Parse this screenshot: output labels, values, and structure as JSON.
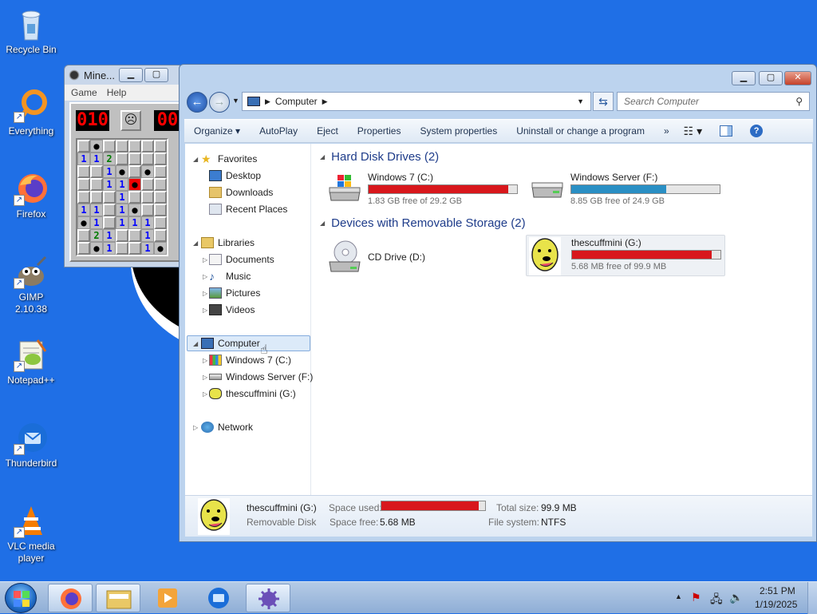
{
  "desktop": {
    "icons": [
      {
        "name": "recycle-bin",
        "label": "Recycle Bin"
      },
      {
        "name": "everything",
        "label": "Everything"
      },
      {
        "name": "firefox",
        "label": "Firefox"
      },
      {
        "name": "gimp",
        "label": "GIMP 2.10.38"
      },
      {
        "name": "notepadpp",
        "label": "Notepad++"
      },
      {
        "name": "thunderbird",
        "label": "Thunderbird"
      },
      {
        "name": "vlc",
        "label": "VLC media player"
      }
    ]
  },
  "minesweeper": {
    "title": "Mine...",
    "menu": [
      "Game",
      "Help"
    ],
    "mine_counter": "010",
    "timer": "00",
    "grid": [
      [
        "",
        "*",
        "",
        "",
        "",
        "",
        ""
      ],
      [
        "1",
        "1",
        "2",
        "",
        "",
        "",
        ""
      ],
      [
        "",
        "",
        "1",
        "*",
        "",
        "*",
        ""
      ],
      [
        "",
        "",
        "1",
        "1",
        "X",
        "",
        ""
      ],
      [
        "",
        "",
        "",
        "1",
        "",
        "",
        ""
      ],
      [
        "1",
        "1",
        "",
        "1",
        "*",
        "",
        ""
      ],
      [
        "*",
        "1",
        "",
        "1",
        "1",
        "1",
        ""
      ],
      [
        "",
        "2",
        "1",
        "",
        "",
        "1",
        ""
      ],
      [
        "",
        "*",
        "1",
        "",
        "",
        "1",
        "*"
      ]
    ]
  },
  "explorer": {
    "address": {
      "path_icon": "computer-icon",
      "segments": [
        "Computer"
      ]
    },
    "search_placeholder": "Search Computer",
    "commands": [
      "Organize ▾",
      "AutoPlay",
      "Eject",
      "Properties",
      "System properties",
      "Uninstall or change a program",
      "»"
    ],
    "nav": {
      "favorites": {
        "label": "Favorites",
        "items": [
          "Desktop",
          "Downloads",
          "Recent Places"
        ]
      },
      "libraries": {
        "label": "Libraries",
        "items": [
          "Documents",
          "Music",
          "Pictures",
          "Videos"
        ]
      },
      "computer": {
        "label": "Computer",
        "items": [
          "Windows 7 (C:)",
          "Windows Server (F:)",
          "thescuffmini (G:)"
        ]
      },
      "network": {
        "label": "Network"
      }
    },
    "groups": [
      {
        "title": "Hard Disk Drives (2)"
      },
      {
        "title": "Devices with Removable Storage (2)"
      }
    ],
    "drives": [
      {
        "name": "Windows 7 (C:)",
        "free_text": "1.83 GB free of 29.2 GB",
        "used_fraction": 0.94,
        "bar_color": "#d8171c"
      },
      {
        "name": "Windows Server (F:)",
        "free_text": "8.85 GB free of 24.9 GB",
        "used_fraction": 0.64,
        "bar_color": "#2a8fc4"
      },
      {
        "name": "CD Drive (D:)"
      },
      {
        "name": "thescuffmini (G:)",
        "free_text": "5.68 MB free of 99.9 MB",
        "used_fraction": 0.94,
        "bar_color": "#d8171c"
      }
    ],
    "status": {
      "name": "thescuffmini (G:)",
      "type": "Removable Disk",
      "space_used_label": "Space used:",
      "space_free_label": "Space free:",
      "space_free": "5.68 MB",
      "total_size_label": "Total size:",
      "total_size": "99.9 MB",
      "filesystem_label": "File system:",
      "filesystem": "NTFS",
      "used_fraction": 0.94
    }
  },
  "taskbar": {
    "time": "2:51 PM",
    "date": "1/19/2025"
  }
}
